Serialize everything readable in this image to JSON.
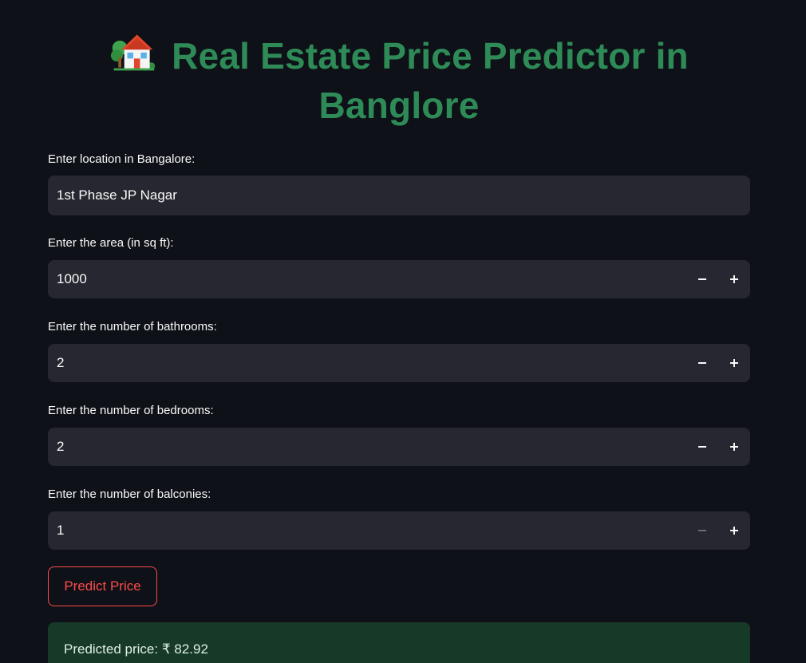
{
  "header": {
    "icon": "house-with-garden-icon",
    "title": "Real Estate Price Predictor in Banglore"
  },
  "form": {
    "location": {
      "label": "Enter location in Bangalore:",
      "value": "1st Phase JP Nagar"
    },
    "area": {
      "label": "Enter the area (in sq ft):",
      "value": "1000"
    },
    "bathrooms": {
      "label": "Enter the number of bathrooms:",
      "value": "2"
    },
    "bedrooms": {
      "label": "Enter the number of bedrooms:",
      "value": "2"
    },
    "balconies": {
      "label": "Enter the number of balconies:",
      "value": "1"
    }
  },
  "actions": {
    "predict_label": "Predict Price"
  },
  "result": {
    "text": "Predicted price: ₹ 82.92"
  },
  "colors": {
    "background": "#0e1117",
    "title": "#2e8b57",
    "input_bg": "#262730",
    "accent": "#ff4b4b",
    "success_bg": "#173928"
  }
}
